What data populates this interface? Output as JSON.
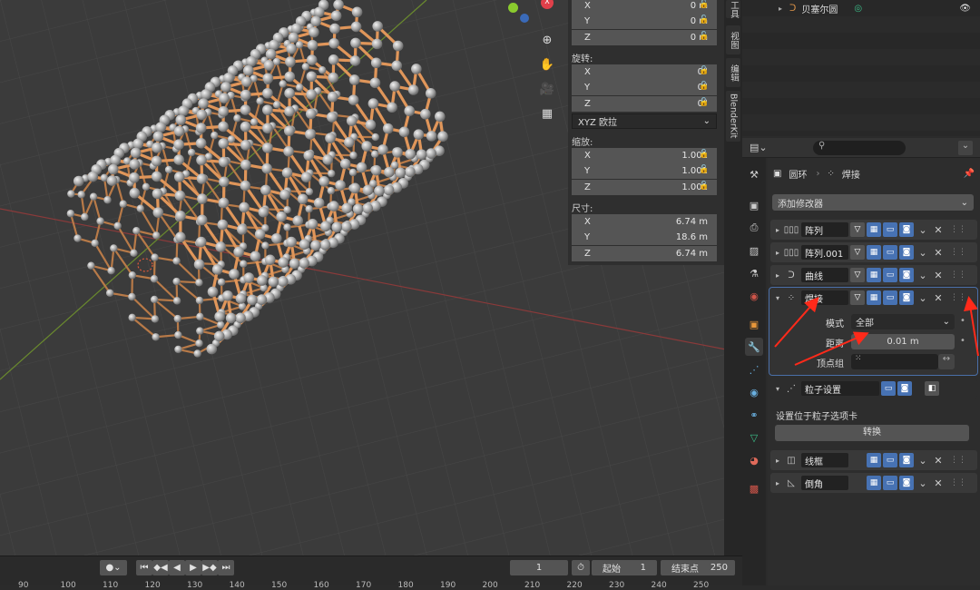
{
  "npanel": {
    "loc_x": "X",
    "loc_x_val": "0 m",
    "loc_y": "Y",
    "loc_y_val": "0 m",
    "loc_z": "Z",
    "loc_z_val": "0 m",
    "rotation_label": "旋转:",
    "rot_x": "X",
    "rot_x_val": "0°",
    "rot_y": "Y",
    "rot_y_val": "0°",
    "rot_z": "Z",
    "rot_z_val": "0°",
    "euler_mode": "XYZ 欧拉",
    "scale_label": "缩放:",
    "scale_x": "X",
    "scale_x_val": "1.001",
    "scale_y": "Y",
    "scale_y_val": "1.001",
    "scale_z": "Z",
    "scale_z_val": "1.001",
    "dimensions_label": "尺寸:",
    "dim_x": "X",
    "dim_x_val": "6.74 m",
    "dim_y": "Y",
    "dim_y_val": "18.6 m",
    "dim_z": "Z",
    "dim_z_val": "6.74 m"
  },
  "sidetabs": {
    "tool": "工具",
    "view": "视图",
    "edit": "编辑",
    "blenderkit": "BlenderKit"
  },
  "outliner": {
    "item": "贝塞尔圆"
  },
  "props": {
    "breadcrumb_object": "圆环",
    "breadcrumb_modifier": "焊接",
    "add_modifier": "添加修改器",
    "modifiers": [
      {
        "name": "阵列"
      },
      {
        "name": "阵列.001"
      },
      {
        "name": "曲线"
      },
      {
        "name": "焊接"
      },
      {
        "name": "粒子设置"
      },
      {
        "name": "线框"
      },
      {
        "name": "倒角"
      }
    ],
    "weld": {
      "mode_label": "模式",
      "mode_value": "全部",
      "distance_label": "距离",
      "distance_value": "0.01 m",
      "vgroup_label": "顶点组"
    },
    "particle_note": "设置位于粒子选项卡",
    "convert_button": "转换"
  },
  "timeline": {
    "current_frame": "1",
    "start_label": "起始",
    "start_value": "1",
    "end_label": "结束点",
    "end_value": "250",
    "ticks": [
      "90",
      "100",
      "110",
      "120",
      "130",
      "140",
      "150",
      "160",
      "170",
      "180",
      "190",
      "200",
      "210",
      "220",
      "230",
      "240",
      "250"
    ]
  },
  "colors": {
    "accent": "#4772b3",
    "orange_bond": "#e0965a",
    "annotation_red": "#ff2a1a"
  }
}
